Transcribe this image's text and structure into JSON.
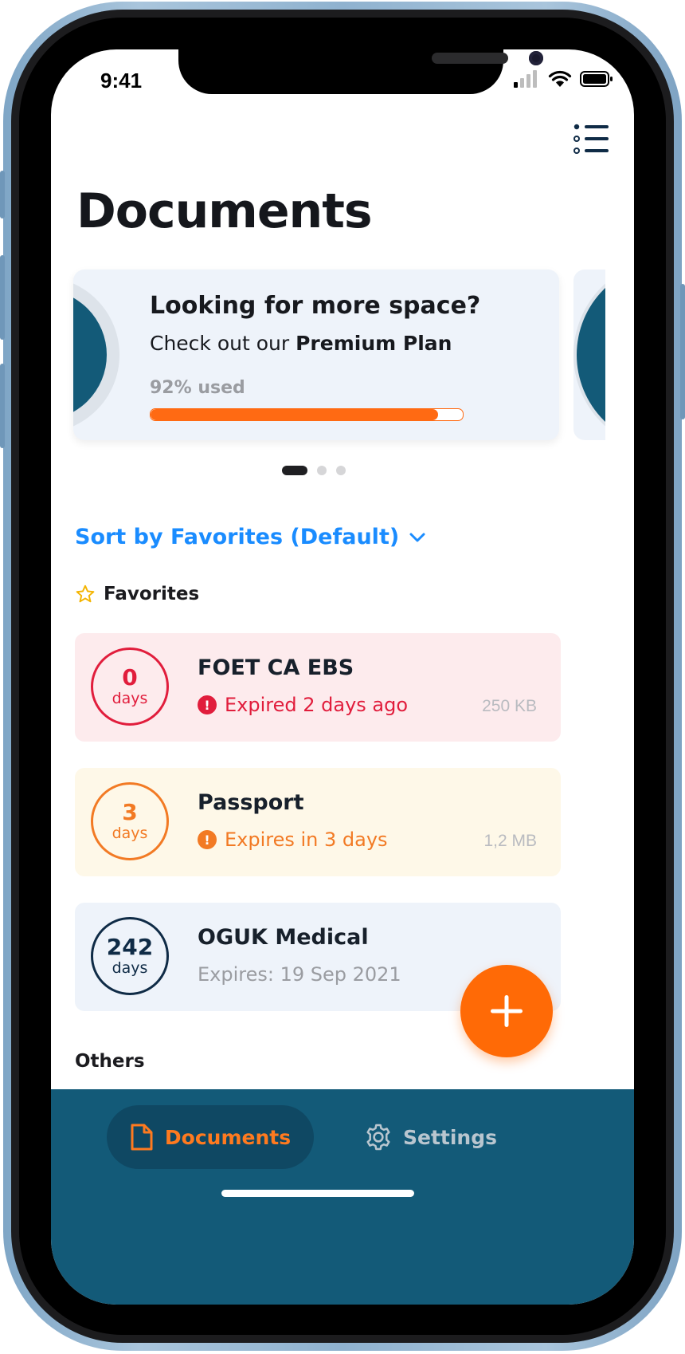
{
  "status_bar": {
    "time": "9:41"
  },
  "header": {
    "title": "Documents",
    "menu_icon": "list-menu-icon"
  },
  "promo": {
    "title": "Looking for more space?",
    "subtitle_prefix": "Check out our ",
    "subtitle_bold": "Premium Plan",
    "usage_label": "92% used",
    "usage_fraction": 0.92,
    "slide_count": 3,
    "active_slide": 0
  },
  "sort": {
    "label": "Sort by Favorites (Default)"
  },
  "sections": {
    "favorites": "Favorites",
    "others": "Others"
  },
  "documents": [
    {
      "count": "0",
      "unit": "days",
      "name": "FOET CA EBS",
      "status": "Expired 2 days ago",
      "size": "250 KB",
      "state": "expired",
      "bg": "#fdebed",
      "color": "#e11d3c"
    },
    {
      "count": "3",
      "unit": "days",
      "name": "Passport",
      "status": "Expires in 3 days",
      "size": "1,2 MB",
      "state": "warning",
      "bg": "#fef8e8",
      "color": "#f27a24"
    },
    {
      "count": "242",
      "unit": "days",
      "name": "OGUK Medical",
      "status": "Expires: 19 Sep 2021",
      "size": "",
      "state": "ok",
      "bg": "#eef3fa",
      "color": "#0f2b46"
    }
  ],
  "fab": {
    "icon": "plus-icon"
  },
  "tabs": {
    "documents": "Documents",
    "settings": "Settings"
  },
  "colors": {
    "accent": "#ff6a06",
    "link": "#1a8cff",
    "tabbar": "#135a78"
  }
}
